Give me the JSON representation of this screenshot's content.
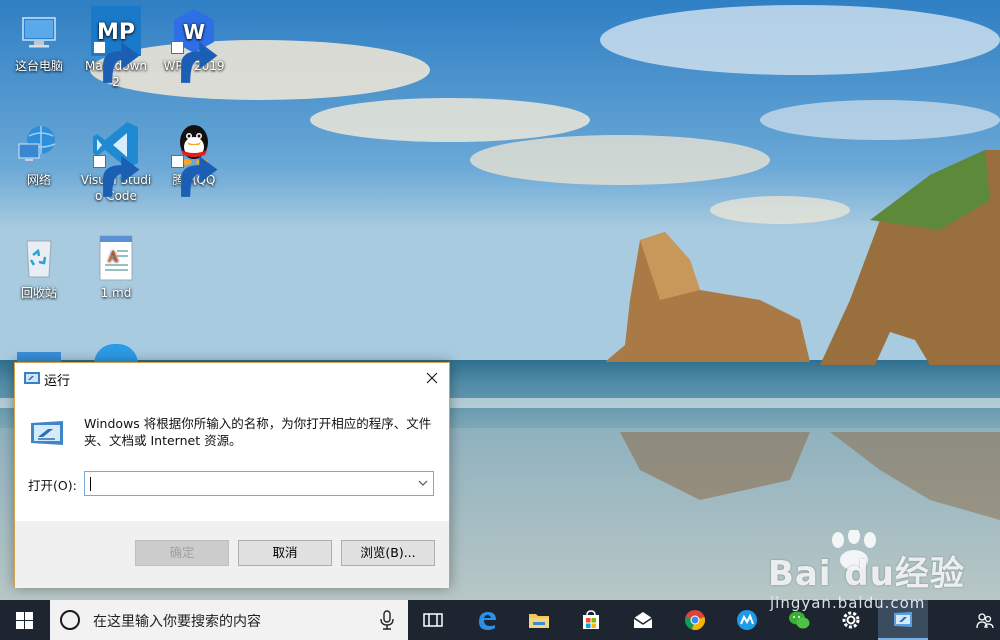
{
  "desktop": {
    "icons": [
      {
        "label": "这台电脑",
        "icon": "this-pc-icon"
      },
      {
        "label": "Markdown 2",
        "icon": "markdownpad-icon",
        "badge": "MP"
      },
      {
        "label": "WPS 2019",
        "icon": "wps-icon"
      },
      {
        "label": "网络",
        "icon": "network-icon"
      },
      {
        "label": "Visual Studio Code",
        "icon": "vscode-icon"
      },
      {
        "label": "腾讯QQ",
        "icon": "qq-icon"
      },
      {
        "label": "回收站",
        "icon": "recycle-bin-icon"
      },
      {
        "label": "1.md",
        "icon": "md-file-icon"
      }
    ]
  },
  "run_dialog": {
    "title": "运行",
    "description": "Windows 将根据你所输入的名称，为你打开相应的程序、文件夹、文档或 Internet 资源。",
    "open_label": "打开(O):",
    "input_value": "",
    "buttons": {
      "ok": "确定",
      "cancel": "取消",
      "browse": "浏览(B)..."
    }
  },
  "taskbar": {
    "search_placeholder": "在这里输入你要搜索的内容",
    "items": [
      "task-view-icon",
      "edge-icon",
      "file-explorer-icon",
      "store-icon",
      "mail-icon",
      "chrome-icon",
      "app-icon",
      "wechat-icon",
      "settings-icon",
      "run-icon"
    ]
  },
  "watermark": {
    "brand": "Bai du经验",
    "url": "jingyan.baidu.com"
  },
  "colors": {
    "taskbar": "#1c2530",
    "dialog_border": "#d4a24a",
    "accent_blue": "#0078d7"
  }
}
